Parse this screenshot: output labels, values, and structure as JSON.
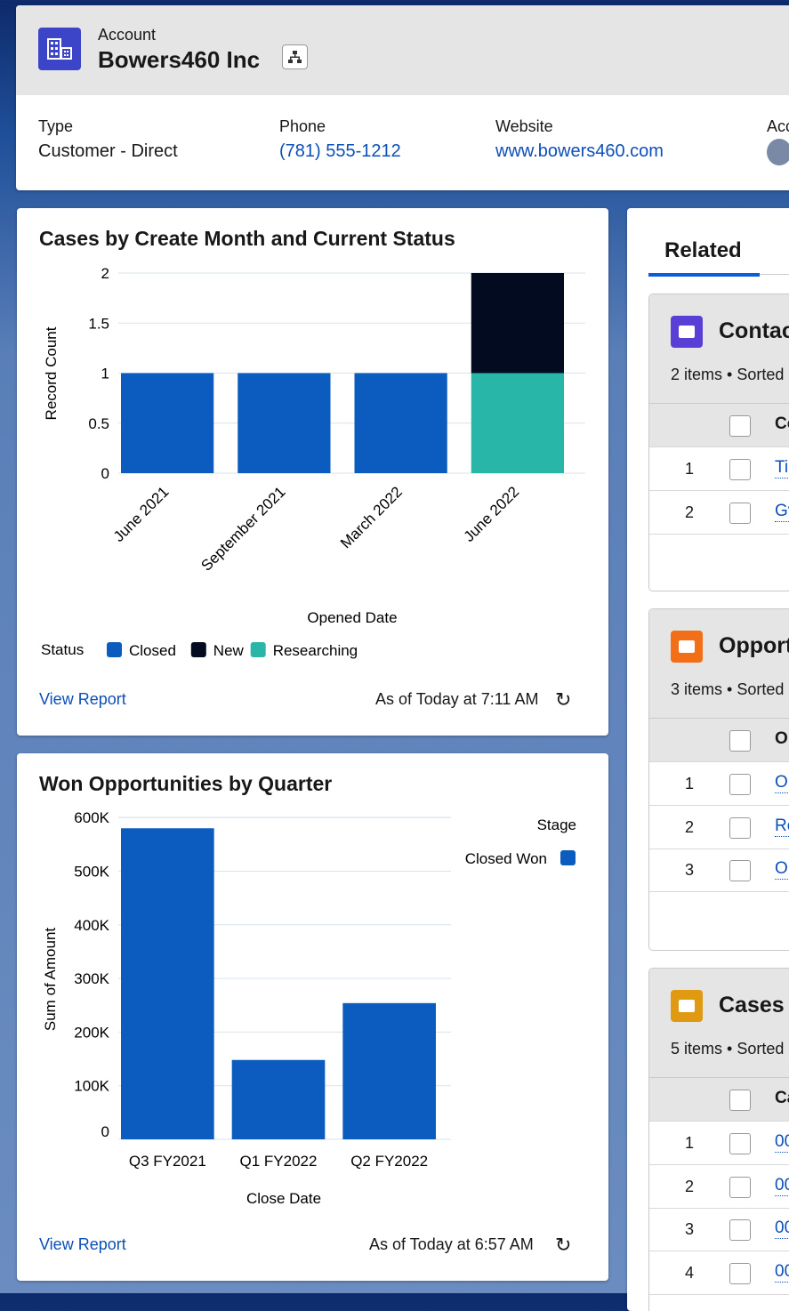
{
  "header": {
    "object_label": "Account",
    "name": "Bowers460 Inc",
    "icon": "building-icon",
    "hierarchy_icon": "hierarchy-icon",
    "fields": [
      {
        "label": "Type",
        "value": "Customer - Direct"
      },
      {
        "label": "Phone",
        "value": "(781) 555-1212"
      },
      {
        "label": "Website",
        "value": "www.bowers460.com"
      },
      {
        "label": "Acc",
        "value": ""
      }
    ]
  },
  "colors": {
    "closed": "#0b5cbe",
    "new": "#020b1f",
    "researching": "#27b6a8",
    "accent": "#0b4fb8",
    "won": "#0b5cbe"
  },
  "chart1": {
    "title": "Cases by Create Month and Current Status",
    "view_report": "View Report",
    "as_of": "As of Today at 7:11 AM",
    "legend_title": "Status"
  },
  "chart2": {
    "title": "Won Opportunities by Quarter",
    "view_report": "View Report",
    "as_of": "As of Today at 6:57 AM",
    "legend_title": "Stage"
  },
  "chart_data": [
    {
      "type": "bar",
      "stacked": true,
      "title": "Cases by Create Month and Current Status",
      "xlabel": "Opened Date",
      "ylabel": "Record Count",
      "ylim": [
        0,
        2
      ],
      "yticks": [
        "0",
        "0.5",
        "1",
        "1.5",
        "2"
      ],
      "grid": true,
      "legend": "bottom",
      "categories": [
        "June 2021",
        "September 2021",
        "March 2022",
        "June 2022"
      ],
      "series": [
        {
          "name": "Closed",
          "values": [
            1,
            1,
            1,
            0
          ]
        },
        {
          "name": "Researching",
          "values": [
            0,
            0,
            0,
            1
          ]
        },
        {
          "name": "New",
          "values": [
            0,
            0,
            0,
            1
          ]
        }
      ],
      "legend_order": [
        "Closed",
        "New",
        "Researching"
      ]
    },
    {
      "type": "bar",
      "title": "Won Opportunities by Quarter",
      "xlabel": "Close Date",
      "ylabel": "Sum of Amount",
      "ylim": [
        0,
        600000
      ],
      "yticks": [
        "0",
        "100K",
        "200K",
        "300K",
        "400K",
        "500K",
        "600K"
      ],
      "grid": true,
      "legend": "top-right",
      "categories": [
        "Q3 FY2021",
        "Q1 FY2022",
        "Q2 FY2022"
      ],
      "series": [
        {
          "name": "Closed Won",
          "values": [
            580000,
            148000,
            254000
          ]
        }
      ]
    }
  ],
  "related": {
    "tab": "Related",
    "panels": [
      {
        "title": "Contacts",
        "icon": "contact-card-icon",
        "color": "#5a3fd6",
        "meta": "2 items • Sorted",
        "col": "Co",
        "rows": [
          {
            "n": "1",
            "v": "Ti"
          },
          {
            "n": "2",
            "v": "Gv"
          }
        ]
      },
      {
        "title": "Opportunities",
        "icon": "crown-icon",
        "color": "#f26e17",
        "meta": "3 items • Sorted",
        "col": "Op",
        "rows": [
          {
            "n": "1",
            "v": "Op"
          },
          {
            "n": "2",
            "v": "Re"
          },
          {
            "n": "3",
            "v": "Op"
          }
        ]
      },
      {
        "title": "Cases",
        "icon": "briefcase-icon",
        "color": "#e09a12",
        "meta": "5 items • Sorted",
        "col": "Ca",
        "rows": [
          {
            "n": "1",
            "v": "00"
          },
          {
            "n": "2",
            "v": "00"
          },
          {
            "n": "3",
            "v": "00"
          },
          {
            "n": "4",
            "v": "00"
          }
        ]
      }
    ]
  }
}
